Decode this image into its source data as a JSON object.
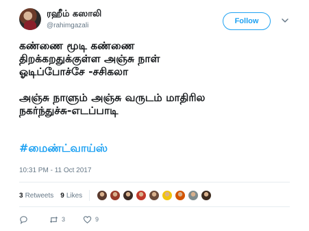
{
  "user": {
    "name": "ரஹீம் கஸாலி",
    "handle": "@rahimgazali"
  },
  "follow_label": "Follow",
  "tweet": {
    "lines": [
      "கண்ணை மூடி கண்ணை",
      "திறக்கறதுக்குள்ள அஞ்சு நாள்",
      "ஓடிப்போச்சே -சசிகலா",
      "",
      "அஞ்சு நாளும் அஞ்சு வருடம் மாதிரில",
      "நகர்ந்துச்சு-எடப்பாடி"
    ],
    "hashtag": "#மைண்ட்வாய்ஸ்"
  },
  "timestamp": "10:31 PM - 11 Oct 2017",
  "stats": {
    "retweets_count": "3",
    "retweets_label": "Retweets",
    "likes_count": "9",
    "likes_label": "Likes"
  },
  "liker_avatar_colors": [
    "#5a3a2e",
    "#9a3b2a",
    "#3c2a24",
    "#c0392b",
    "#6b4a3a",
    "#f1c40f",
    "#d35400",
    "#7f8c8d",
    "#3d2b1f"
  ],
  "actions": {
    "reply_count": "",
    "retweet_count": "3",
    "like_count": "9"
  },
  "colors": {
    "accent": "#1da1f2",
    "text": "#14171a",
    "muted": "#657786"
  }
}
